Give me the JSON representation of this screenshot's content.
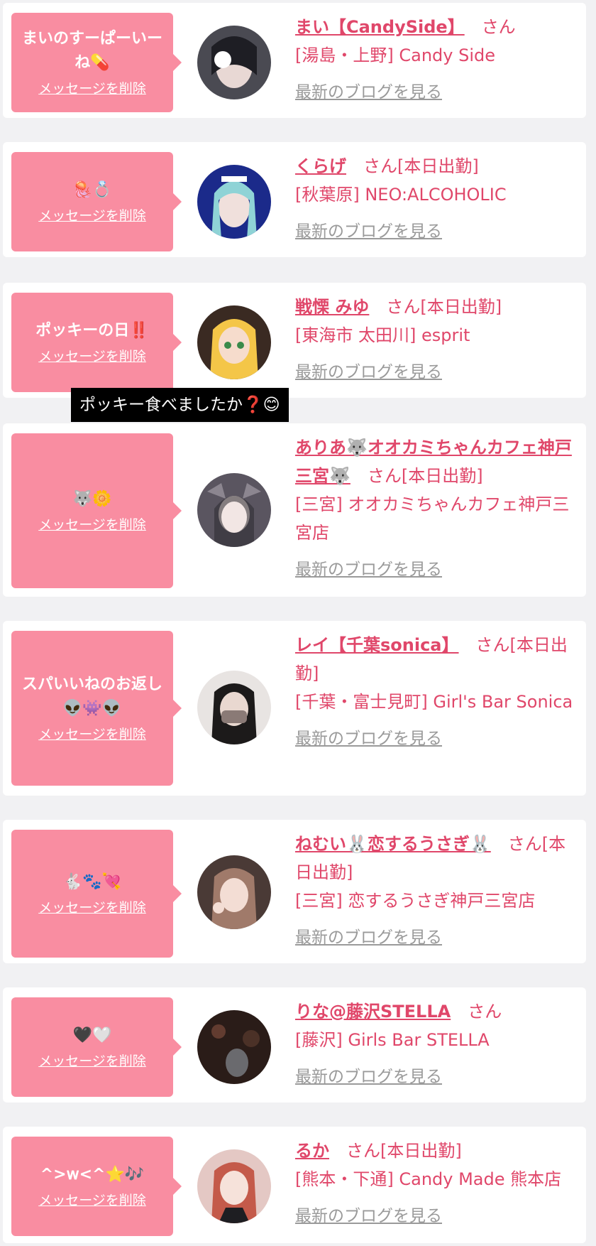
{
  "colors": {
    "accent": "#e0476a",
    "bubble": "#f98da1",
    "link_gray": "#9a9a9a"
  },
  "common": {
    "delete_label": "メッセージを削除",
    "blog_label": "最新のブログを見る"
  },
  "tooltip": "ポッキー食べましたか❓😊",
  "items": [
    {
      "message": "まいのすーぱーいーね💊",
      "name": "まい【CandySide】",
      "suffix": "さん",
      "shop": "[湯島・上野] Candy Side"
    },
    {
      "message": "🪼💍",
      "name": "くらげ",
      "suffix": "さん[本日出勤]",
      "shop": "[秋葉原] NEO:ALCOHOLIC"
    },
    {
      "message": "ポッキーの日‼️",
      "name": "戦慄 みゆ",
      "suffix": "さん[本日出勤]",
      "shop": "[東海市 太田川] esprit"
    },
    {
      "message": "🐺🌼",
      "name": "ありあ🐺オオカミちゃんカフェ神戸三宮🐺",
      "suffix": "さん[本日出勤]",
      "shop": "[三宮] オオカミちゃんカフェ神戸三宮店"
    },
    {
      "message": "スパいいねのお返し👽👾👽",
      "name": "レイ【千葉sonica】",
      "suffix": "さん[本日出勤]",
      "shop": "[千葉・富士見町] Girl's Bar Sonica"
    },
    {
      "message": "🐇🐾💘",
      "name": "ねむい🐰恋するうさぎ🐰",
      "suffix": "さん[本日出勤]",
      "shop": "[三宮] 恋するうさぎ神戸三宮店"
    },
    {
      "message": "🖤🤍",
      "name": "りな@藤沢STELLA",
      "suffix": "さん",
      "shop": "[藤沢] Girls Bar STELLA"
    },
    {
      "message": "^>𝗐<^⭐️🎶",
      "name": "るか",
      "suffix": "さん[本日出勤]",
      "shop": "[熊本・下通] Candy Made 熊本店"
    }
  ]
}
